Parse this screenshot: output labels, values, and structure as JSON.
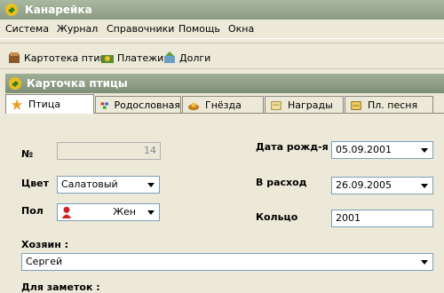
{
  "window": {
    "title": "Канарейка"
  },
  "menu": {
    "items": [
      "Система",
      "Журнал",
      "Справочники",
      "Помощь",
      "Окна"
    ]
  },
  "toolbar": {
    "items": [
      "Картотека птиц",
      "Платежи",
      "Долги"
    ]
  },
  "card": {
    "title": "Карточка птицы"
  },
  "tabs": [
    "Птица",
    "Родословная",
    "Гнёзда",
    "Награды",
    "Пл. песня"
  ],
  "form": {
    "number_label": "№",
    "number_value": "14",
    "color_label": "Цвет",
    "color_value": "Салатовый",
    "sex_label": "Пол",
    "sex_value": "Жен",
    "birth_label": "Дата рожд-я",
    "birth_value": "05.09.2001",
    "out_label": "В расход",
    "out_value": "26.09.2005",
    "ring_label": "Кольцо",
    "ring_value": "2001",
    "owner_label": "Хозяин :",
    "owner_value": "Сергей",
    "notes_label": "Для заметок :"
  }
}
